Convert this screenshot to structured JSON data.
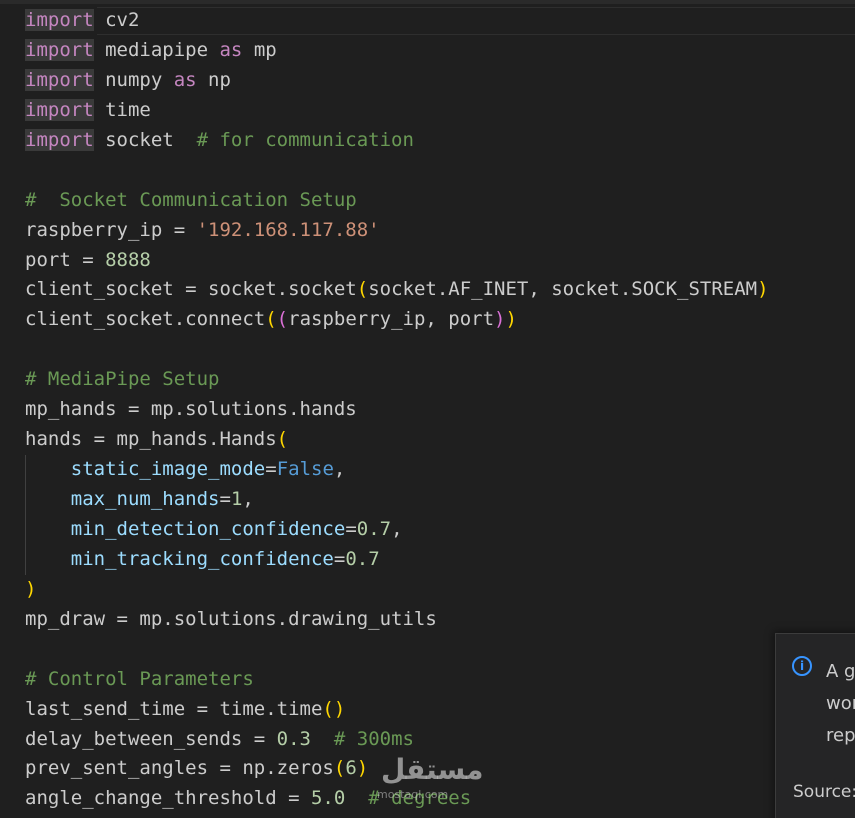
{
  "editor": {
    "lines": [
      [
        {
          "t": "import",
          "c": "kw",
          "hl": true
        },
        {
          "t": " cv2",
          "c": "id"
        }
      ],
      [
        {
          "t": "import",
          "c": "kw",
          "hl": true
        },
        {
          "t": " mediapipe ",
          "c": "id"
        },
        {
          "t": "as",
          "c": "kw"
        },
        {
          "t": " mp",
          "c": "id"
        }
      ],
      [
        {
          "t": "import",
          "c": "kw",
          "hl": true
        },
        {
          "t": " numpy ",
          "c": "id"
        },
        {
          "t": "as",
          "c": "kw"
        },
        {
          "t": " np",
          "c": "id"
        }
      ],
      [
        {
          "t": "import",
          "c": "kw",
          "hl": true
        },
        {
          "t": " time",
          "c": "id"
        }
      ],
      [
        {
          "t": "import",
          "c": "kw",
          "hl": true
        },
        {
          "t": " socket  ",
          "c": "id"
        },
        {
          "t": "# for communication",
          "c": "cm"
        }
      ],
      [],
      [
        {
          "t": "#  Socket Communication Setup",
          "c": "cm"
        }
      ],
      [
        {
          "t": "raspberry_ip = ",
          "c": "id"
        },
        {
          "t": "'192.168.117.88'",
          "c": "str"
        }
      ],
      [
        {
          "t": "port = ",
          "c": "id"
        },
        {
          "t": "8888",
          "c": "num"
        }
      ],
      [
        {
          "t": "client_socket = socket.socket",
          "c": "id"
        },
        {
          "t": "(",
          "c": "br"
        },
        {
          "t": "socket.AF_INET, socket.SOCK_STREAM",
          "c": "id"
        },
        {
          "t": ")",
          "c": "br"
        }
      ],
      [
        {
          "t": "client_socket.connect",
          "c": "id"
        },
        {
          "t": "(",
          "c": "br"
        },
        {
          "t": "(",
          "c": "br2"
        },
        {
          "t": "raspberry_ip, port",
          "c": "id"
        },
        {
          "t": ")",
          "c": "br2"
        },
        {
          "t": ")",
          "c": "br"
        }
      ],
      [],
      [
        {
          "t": "# MediaPipe Setup",
          "c": "cm"
        }
      ],
      [
        {
          "t": "mp_hands = mp.solutions.hands",
          "c": "id"
        }
      ],
      [
        {
          "t": "hands = mp_hands.Hands",
          "c": "id"
        },
        {
          "t": "(",
          "c": "br"
        }
      ],
      [
        {
          "t": "    ",
          "c": "id",
          "guide": true
        },
        {
          "t": "static_image_mode",
          "c": "param"
        },
        {
          "t": "=",
          "c": "op"
        },
        {
          "t": "False",
          "c": "const"
        },
        {
          "t": ",",
          "c": "id"
        }
      ],
      [
        {
          "t": "    ",
          "c": "id",
          "guide": true
        },
        {
          "t": "max_num_hands",
          "c": "param"
        },
        {
          "t": "=",
          "c": "op"
        },
        {
          "t": "1",
          "c": "num"
        },
        {
          "t": ",",
          "c": "id"
        }
      ],
      [
        {
          "t": "    ",
          "c": "id",
          "guide": true
        },
        {
          "t": "min_detection_confidence",
          "c": "param"
        },
        {
          "t": "=",
          "c": "op"
        },
        {
          "t": "0.7",
          "c": "num"
        },
        {
          "t": ",",
          "c": "id"
        }
      ],
      [
        {
          "t": "    ",
          "c": "id",
          "guide": true
        },
        {
          "t": "min_tracking_confidence",
          "c": "param"
        },
        {
          "t": "=",
          "c": "op"
        },
        {
          "t": "0.7",
          "c": "num"
        }
      ],
      [
        {
          "t": ")",
          "c": "br"
        }
      ],
      [
        {
          "t": "mp_draw = mp.solutions.drawing_utils",
          "c": "id"
        }
      ],
      [],
      [
        {
          "t": "# Control Parameters",
          "c": "cm"
        }
      ],
      [
        {
          "t": "last_send_time = time.time",
          "c": "id"
        },
        {
          "t": "()",
          "c": "br"
        }
      ],
      [
        {
          "t": "delay_between_sends = ",
          "c": "id"
        },
        {
          "t": "0.3",
          "c": "num"
        },
        {
          "t": "  ",
          "c": "id"
        },
        {
          "t": "# 300ms",
          "c": "cm"
        }
      ],
      [
        {
          "t": "prev_sent_angles = np.zeros",
          "c": "id"
        },
        {
          "t": "(",
          "c": "br"
        },
        {
          "t": "6",
          "c": "num"
        },
        {
          "t": ")",
          "c": "br"
        }
      ],
      [
        {
          "t": "angle_change_threshold = ",
          "c": "id"
        },
        {
          "t": "5.0",
          "c": "num"
        },
        {
          "t": "  ",
          "c": "id"
        },
        {
          "t": "# degrees",
          "c": "cm"
        }
      ]
    ]
  },
  "notification": {
    "icon": "info-icon",
    "icon_glyph": "i",
    "message_line1": "A g",
    "message_line2": "wor",
    "message_line3": "rep",
    "source_label": "Source:"
  },
  "watermark": {
    "text": "مستقل",
    "subtext": "mostaql.com"
  },
  "colors": {
    "background": "#1f1f1f",
    "keyword": "#c586c0",
    "string": "#ce9178",
    "number": "#b5cea8",
    "comment": "#6a9955",
    "bracket": "#ffd700",
    "parameter": "#9cdcfe",
    "constant": "#569cd6",
    "info_accent": "#3794ff"
  }
}
